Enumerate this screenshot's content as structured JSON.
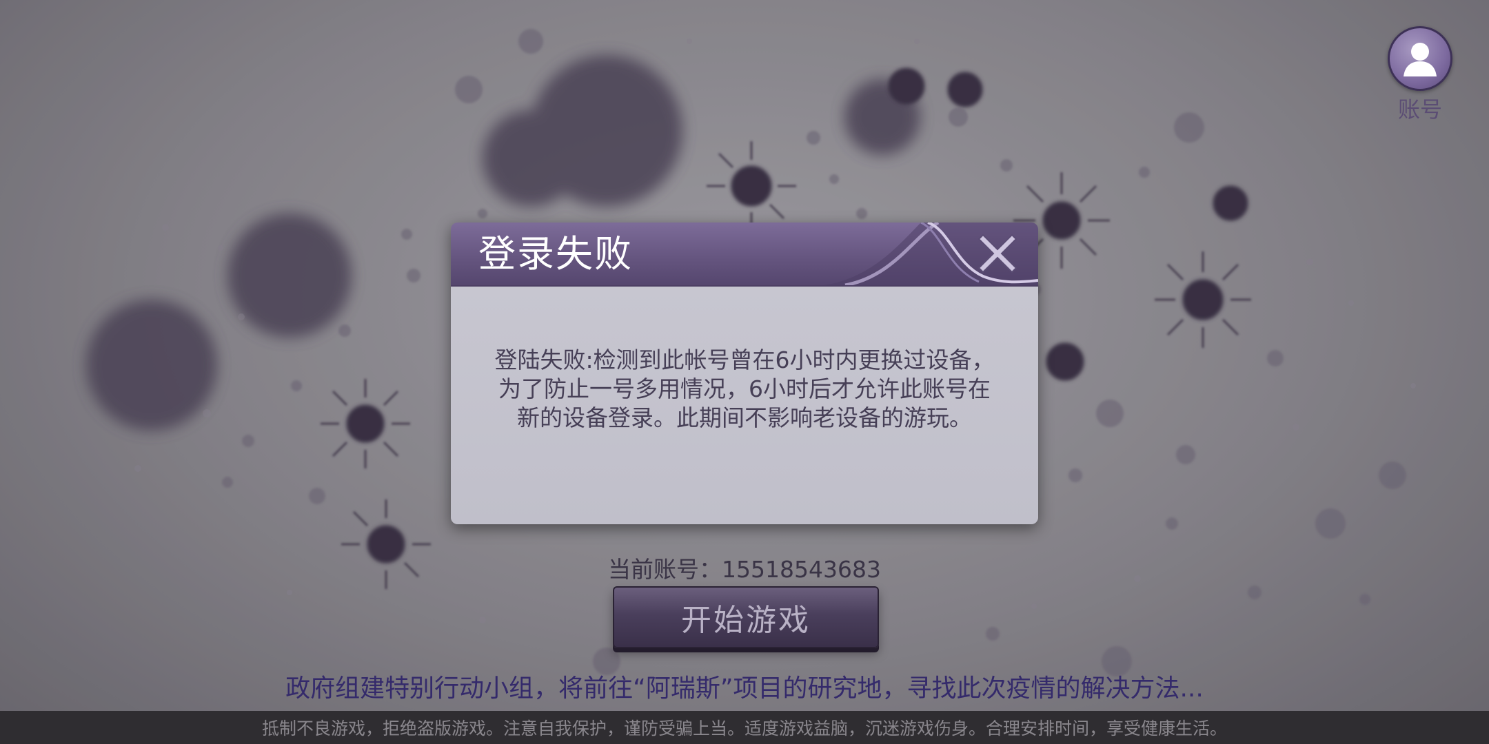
{
  "app": {
    "account_label": "账号",
    "account_icon": "user-silhouette-icon"
  },
  "dialog": {
    "title": "登录失败",
    "close_icon": "close-x-icon",
    "message": "登陆失败:检测到此帐号曾在6小时内更换过设备，为了防止一号多用情况，6小时后才允许此账号在新的设备登录。此期间不影响老设备的游玩。"
  },
  "current_account": {
    "label": "当前账号：",
    "number": "15518543683"
  },
  "start_button": {
    "label": "开始游戏"
  },
  "story_text": "政府组建特别行动小组，将前往“阿瑞斯”项目的研究地，寻找此次疫情的解决方法...",
  "footer_notice": "抵制不良游戏，拒绝盗版游戏。注意自我保护，谨防受骗上当。适度游戏益脑，沉迷游戏伤身。合理安排时间，享受健康生活。",
  "colors": {
    "dialog_header": "#64547e",
    "dialog_body": "#c4c3cd",
    "story_text": "#342a6b",
    "footer_bg": "#2f2d31"
  }
}
